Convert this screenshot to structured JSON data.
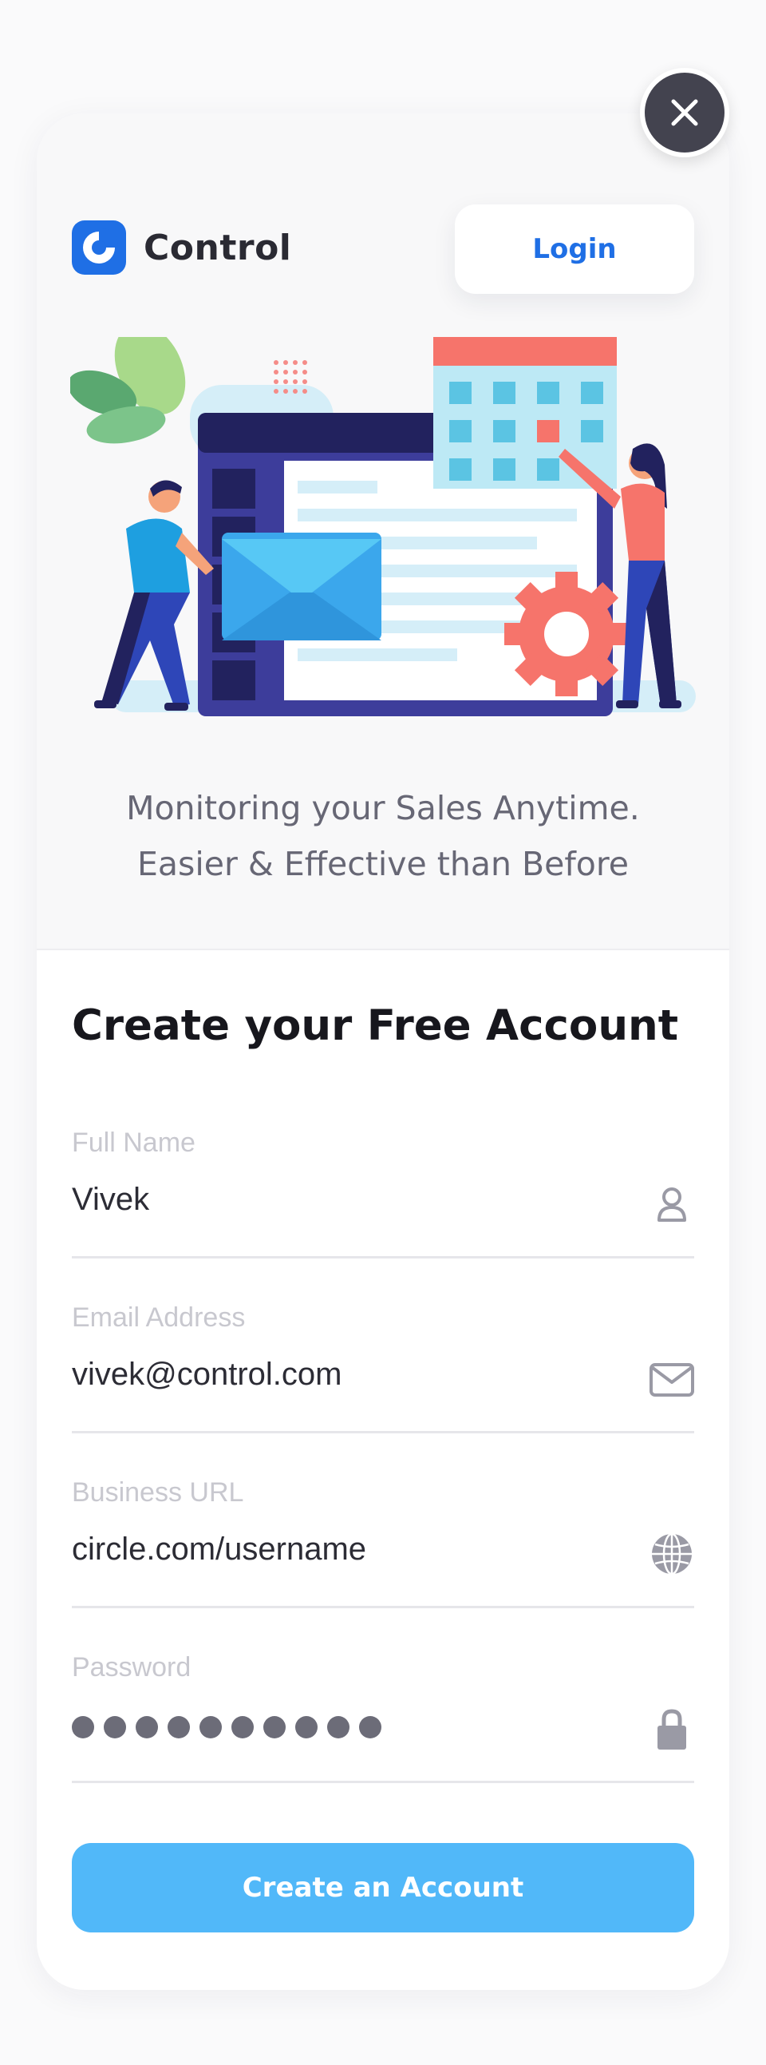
{
  "brand": {
    "name": "Control",
    "logo_icon": "control-logo-icon",
    "accent": "#1f6fe5"
  },
  "header": {
    "login_label": "Login",
    "close_icon": "close-icon"
  },
  "hero": {
    "illustration": "sales-dashboard-illustration",
    "tagline_line1": "Monitoring your Sales Anytime.",
    "tagline_line2": "Easier & Effective than Before"
  },
  "form": {
    "title": "Create your Free Account",
    "fields": [
      {
        "label": "Full Name",
        "value": "Vivek",
        "icon": "user-icon"
      },
      {
        "label": "Email Address",
        "value": "vivek@control.com",
        "icon": "envelope-icon"
      },
      {
        "label": "Business URL",
        "value": "circle.com/username",
        "icon": "globe-icon"
      },
      {
        "label": "Password",
        "value_masked_count": 10,
        "icon": "lock-icon"
      }
    ],
    "submit_label": "Create an Account",
    "submit_color": "#51b8f9"
  }
}
